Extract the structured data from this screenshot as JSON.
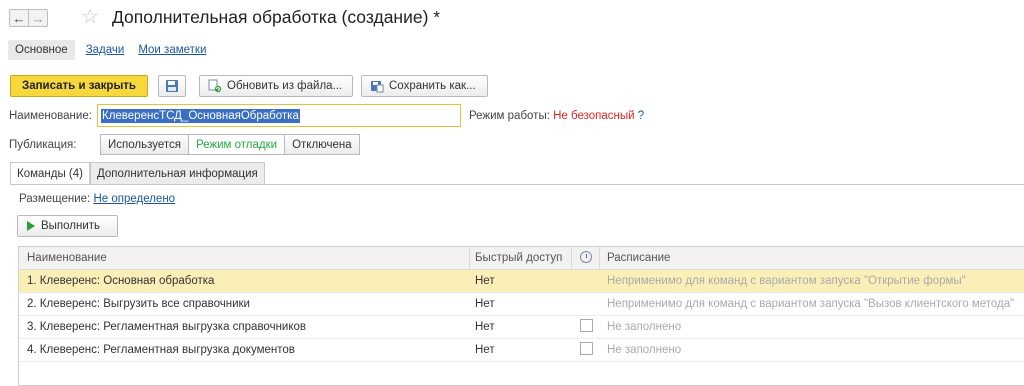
{
  "window": {
    "back_glyph": "←",
    "forward_glyph": "→",
    "star_glyph": "☆",
    "title": "Дополнительная обработка (создание) *"
  },
  "nav": {
    "tabs": [
      {
        "label": "Основное"
      },
      {
        "label": "Задачи"
      },
      {
        "label": "Мои заметки"
      }
    ]
  },
  "toolbar": {
    "save_close_label": "Записать и закрыть",
    "update_from_file_label": "Обновить из файла...",
    "save_as_label": "Сохранить как..."
  },
  "form": {
    "name_label": "Наименование:",
    "name_value": "КлеверенсТСД_ОсновнаяОбработка",
    "mode_label": "Режим работы:",
    "mode_value": "Не безопасный",
    "mode_help": "?",
    "publication_label": "Публикация:",
    "publication_options": [
      {
        "label": "Используется"
      },
      {
        "label": "Режим отладки"
      },
      {
        "label": "Отключена"
      }
    ],
    "publication_selected": "Режим отладки"
  },
  "tabs": [
    {
      "label": "Команды (4)"
    },
    {
      "label": "Дополнительная информация"
    }
  ],
  "commands": {
    "placement_label": "Размещение:",
    "placement_value": "Не определено",
    "execute_label": "Выполнить",
    "columns": {
      "name": "Наименование",
      "quick_access": "Быстрый доступ",
      "schedule": "Расписание"
    },
    "rows": [
      {
        "name": "1. Клеверенс: Основная обработка",
        "quick": "Нет",
        "has_check": false,
        "schedule": "Неприменимо для команд с вариантом запуска \"Открытие формы\""
      },
      {
        "name": "2. Клеверенс: Выгрузить все справочники",
        "quick": "Нет",
        "has_check": false,
        "schedule": "Неприменимо для команд с вариантом запуска \"Вызов клиентского метода\""
      },
      {
        "name": "3. Клеверенс: Регламентная выгрузка справочников",
        "quick": "Нет",
        "has_check": true,
        "schedule": "Не заполнено"
      },
      {
        "name": "4. Клеверенс: Регламентная выгрузка документов",
        "quick": "Нет",
        "has_check": true,
        "schedule": "Не заполнено"
      }
    ],
    "selected_row": 0
  },
  "colors": {
    "accent_yellow": "#f7d83c",
    "link_blue": "#1a56a6",
    "danger_red": "#e0261f",
    "active_green": "#28a745",
    "selected_row": "#fbefb8"
  }
}
